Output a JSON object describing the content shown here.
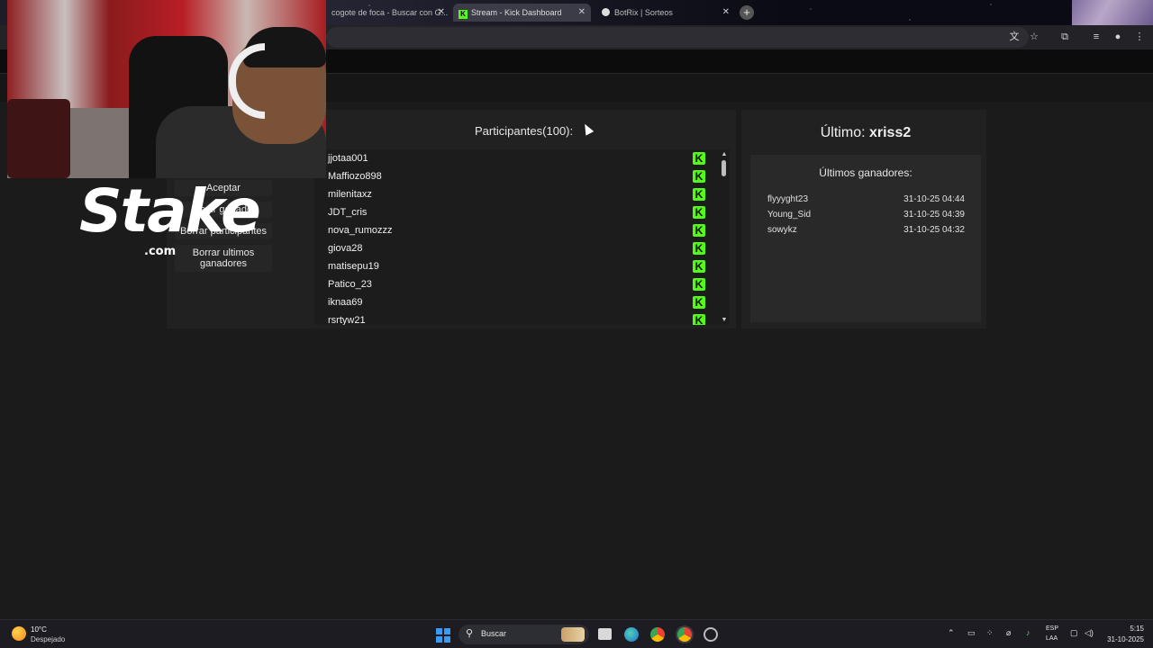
{
  "browser": {
    "tabs": [
      {
        "label": "cogote de foca - Buscar con G..."
      },
      {
        "label": "Stream - Kick Dashboard"
      },
      {
        "label": "BotRix | Sorteos"
      }
    ],
    "close_glyph": "✕",
    "new_tab_glyph": "+"
  },
  "giveaway": {
    "controls": [
      {
        "label": "Aceptar"
      },
      {
        "label": "Elegir ganador"
      },
      {
        "label": "Borrar participantes"
      },
      {
        "label": "Borrar ultimos ganadores"
      }
    ],
    "participants_title": "Participantes(100):",
    "participants": [
      "jjotaa001",
      "Maffiozo898",
      "milenitaxz",
      "JDT_cris",
      "nova_rumozzz",
      "giova28",
      "matisepu19",
      "Patico_23",
      "iknaa69",
      "rsrtyw21"
    ],
    "platform_badge": "K",
    "last_winner_label": "Último:",
    "last_winner_name": "xriss2",
    "winners_title": "Últimos ganadores:",
    "winners": [
      {
        "name": "flyyyght23",
        "date": "31-10-25 04:44"
      },
      {
        "name": "Young_Sid",
        "date": "31-10-25 04:39"
      },
      {
        "name": "sowykz",
        "date": "31-10-25 04:32"
      }
    ],
    "scroll_up_glyph": "▲",
    "scroll_down_glyph": "▼"
  },
  "overlay": {
    "logo_word": "Stake",
    "logo_suffix": ".com"
  },
  "taskbar": {
    "temperature": "10°C",
    "weather": "Despejado",
    "search_label": "Buscar",
    "lang_top": "ESP",
    "lang_bottom": "LAA",
    "time": "5:15",
    "date": "31-10-2025"
  },
  "colors": {
    "kick_green": "#53fc18",
    "panel_bg": "#212121",
    "page_bg": "#1b1b1b"
  }
}
